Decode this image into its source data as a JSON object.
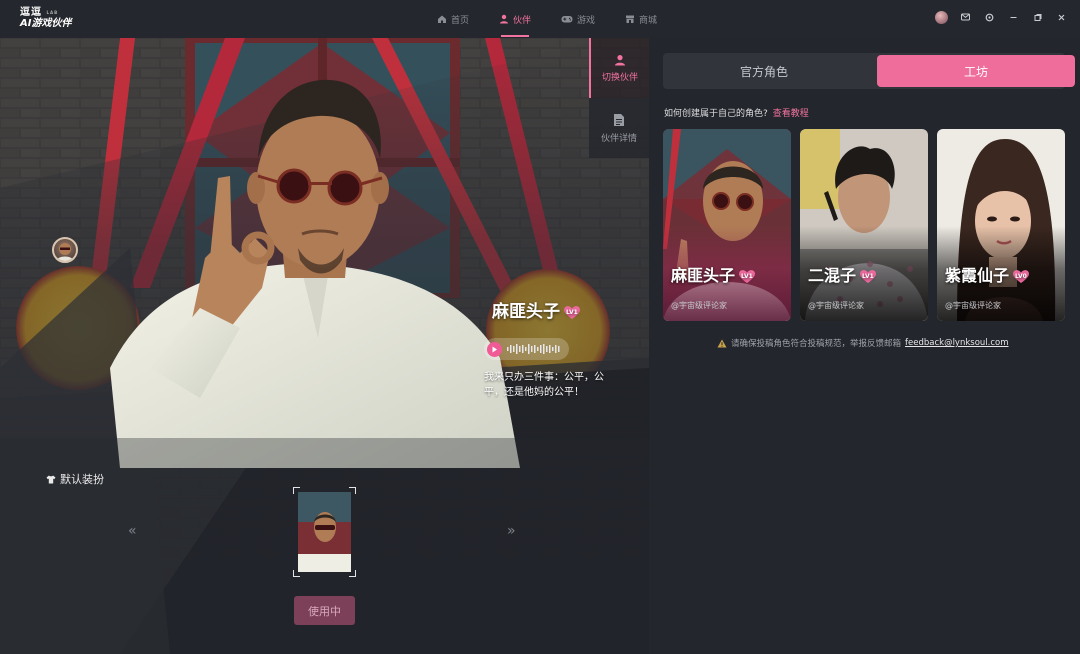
{
  "app": {
    "logo_line1": "逗逗",
    "logo_line2": "AI游戏伙伴",
    "logo_sup": "LAB"
  },
  "nav": {
    "items": [
      {
        "label": "首页",
        "icon": "home-icon",
        "active": false
      },
      {
        "label": "伙伴",
        "icon": "person-icon",
        "active": true
      },
      {
        "label": "游戏",
        "icon": "gamepad-icon",
        "active": false
      },
      {
        "label": "商城",
        "icon": "store-icon",
        "active": false
      }
    ]
  },
  "window_controls": [
    "avatar",
    "mail-icon",
    "settings-icon",
    "minimize-icon",
    "restore-icon",
    "close-icon"
  ],
  "side_tabs": [
    {
      "label": "切换伙伴",
      "icon": "person-icon",
      "active": true
    },
    {
      "label": "伙伴详情",
      "icon": "document-icon",
      "active": false
    }
  ],
  "character": {
    "name": "麻匪头子",
    "level": "LV1",
    "quote": "我来只办三件事：公平，公平，还是他妈的公平！"
  },
  "outfit": {
    "label": "默认装扮",
    "button_label": "使用中"
  },
  "panel": {
    "tabs": [
      {
        "label": "官方角色",
        "active": false
      },
      {
        "label": "工坊",
        "active": true
      }
    ],
    "howto_text": "如何创建属于自己的角色?",
    "howto_link": "查看教程",
    "cards": [
      {
        "name": "麻匪头子",
        "level": "LV1",
        "author": "@宇宙级评论家",
        "selected": true
      },
      {
        "name": "二混子",
        "level": "LV1",
        "author": "@宇宙级评论家",
        "selected": false
      },
      {
        "name": "紫霞仙子",
        "level": "LV0",
        "author": "@宇宙级评论家",
        "selected": false
      }
    ],
    "notice_text": "请确保投稿角色符合投稿规范，举报反馈邮箱",
    "notice_email": "feedback@lynksoul.com"
  },
  "colors": {
    "accent": "#ef6d9a",
    "background": "#23262c"
  }
}
